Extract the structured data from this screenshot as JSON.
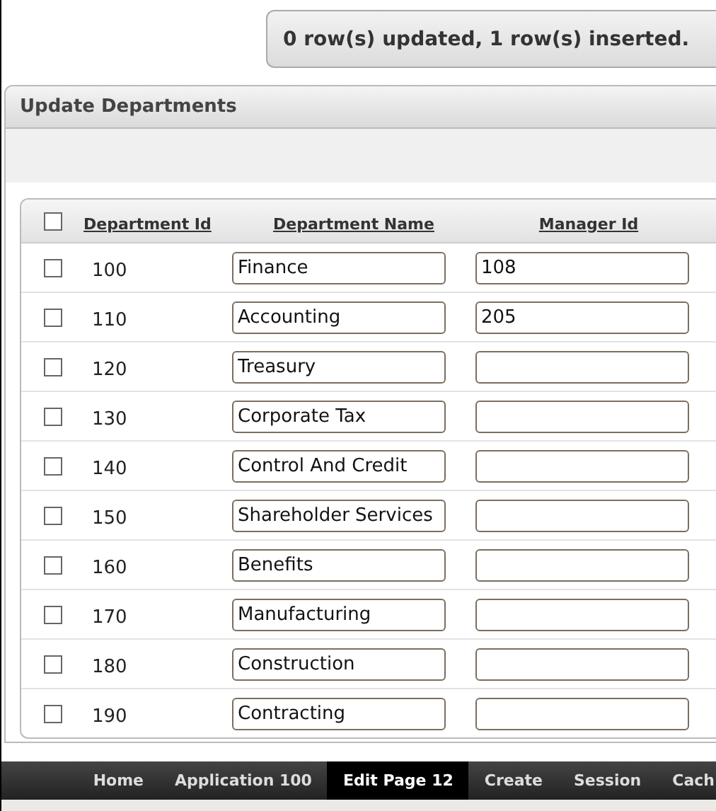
{
  "message": "0 row(s) updated, 1 row(s) inserted.",
  "region": {
    "title": "Update Departments"
  },
  "table": {
    "select_all": {
      "checked": false
    },
    "columns": [
      "Department Id",
      "Department Name",
      "Manager Id"
    ],
    "rows": [
      {
        "checked": false,
        "id": "100",
        "name": "Finance",
        "manager": "108"
      },
      {
        "checked": false,
        "id": "110",
        "name": "Accounting",
        "manager": "205"
      },
      {
        "checked": false,
        "id": "120",
        "name": "Treasury"
      },
      {
        "checked": false,
        "id": "130",
        "name": "Corporate Tax"
      },
      {
        "checked": false,
        "id": "140",
        "name": "Control And Credit"
      },
      {
        "checked": false,
        "id": "150",
        "name": "Shareholder Services"
      },
      {
        "checked": false,
        "id": "160",
        "name": "Benefits"
      },
      {
        "checked": false,
        "id": "170",
        "name": "Manufacturing"
      },
      {
        "checked": false,
        "id": "180",
        "name": "Construction"
      },
      {
        "checked": false,
        "id": "190",
        "name": "Contracting"
      }
    ]
  },
  "dev_toolbar": [
    {
      "label": "Home",
      "selected": false
    },
    {
      "label": "Application 100",
      "selected": false
    },
    {
      "label": "Edit Page 12",
      "selected": true
    },
    {
      "label": "Create",
      "selected": false
    },
    {
      "label": "Session",
      "selected": false
    },
    {
      "label": "Cach",
      "selected": false
    }
  ]
}
